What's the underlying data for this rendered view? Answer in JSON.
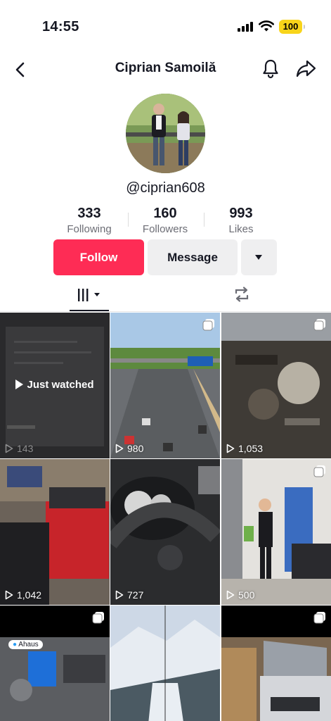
{
  "status_bar": {
    "time": "14:55",
    "battery": "100"
  },
  "nav": {
    "title": "Ciprian Samoilă",
    "back_icon": "chevron-left-icon",
    "bell_icon": "bell-icon",
    "share_icon": "share-arrow-icon"
  },
  "profile": {
    "username": "@ciprian608",
    "stats": [
      {
        "value": "333",
        "label": "Following"
      },
      {
        "value": "160",
        "label": "Followers"
      },
      {
        "value": "993",
        "label": "Likes"
      }
    ]
  },
  "actions": {
    "follow": "Follow",
    "message": "Message"
  },
  "colors": {
    "accent": "#fe2c55",
    "battery": "#f8d41a"
  },
  "videos": [
    {
      "views": "143",
      "overlay": "Just watched"
    },
    {
      "views": "980"
    },
    {
      "views": "1,053"
    },
    {
      "views": "1,042"
    },
    {
      "views": "727"
    },
    {
      "views": "500"
    },
    {
      "views": "",
      "badge": "Ahaus"
    },
    {
      "views": ""
    },
    {
      "views": ""
    }
  ]
}
